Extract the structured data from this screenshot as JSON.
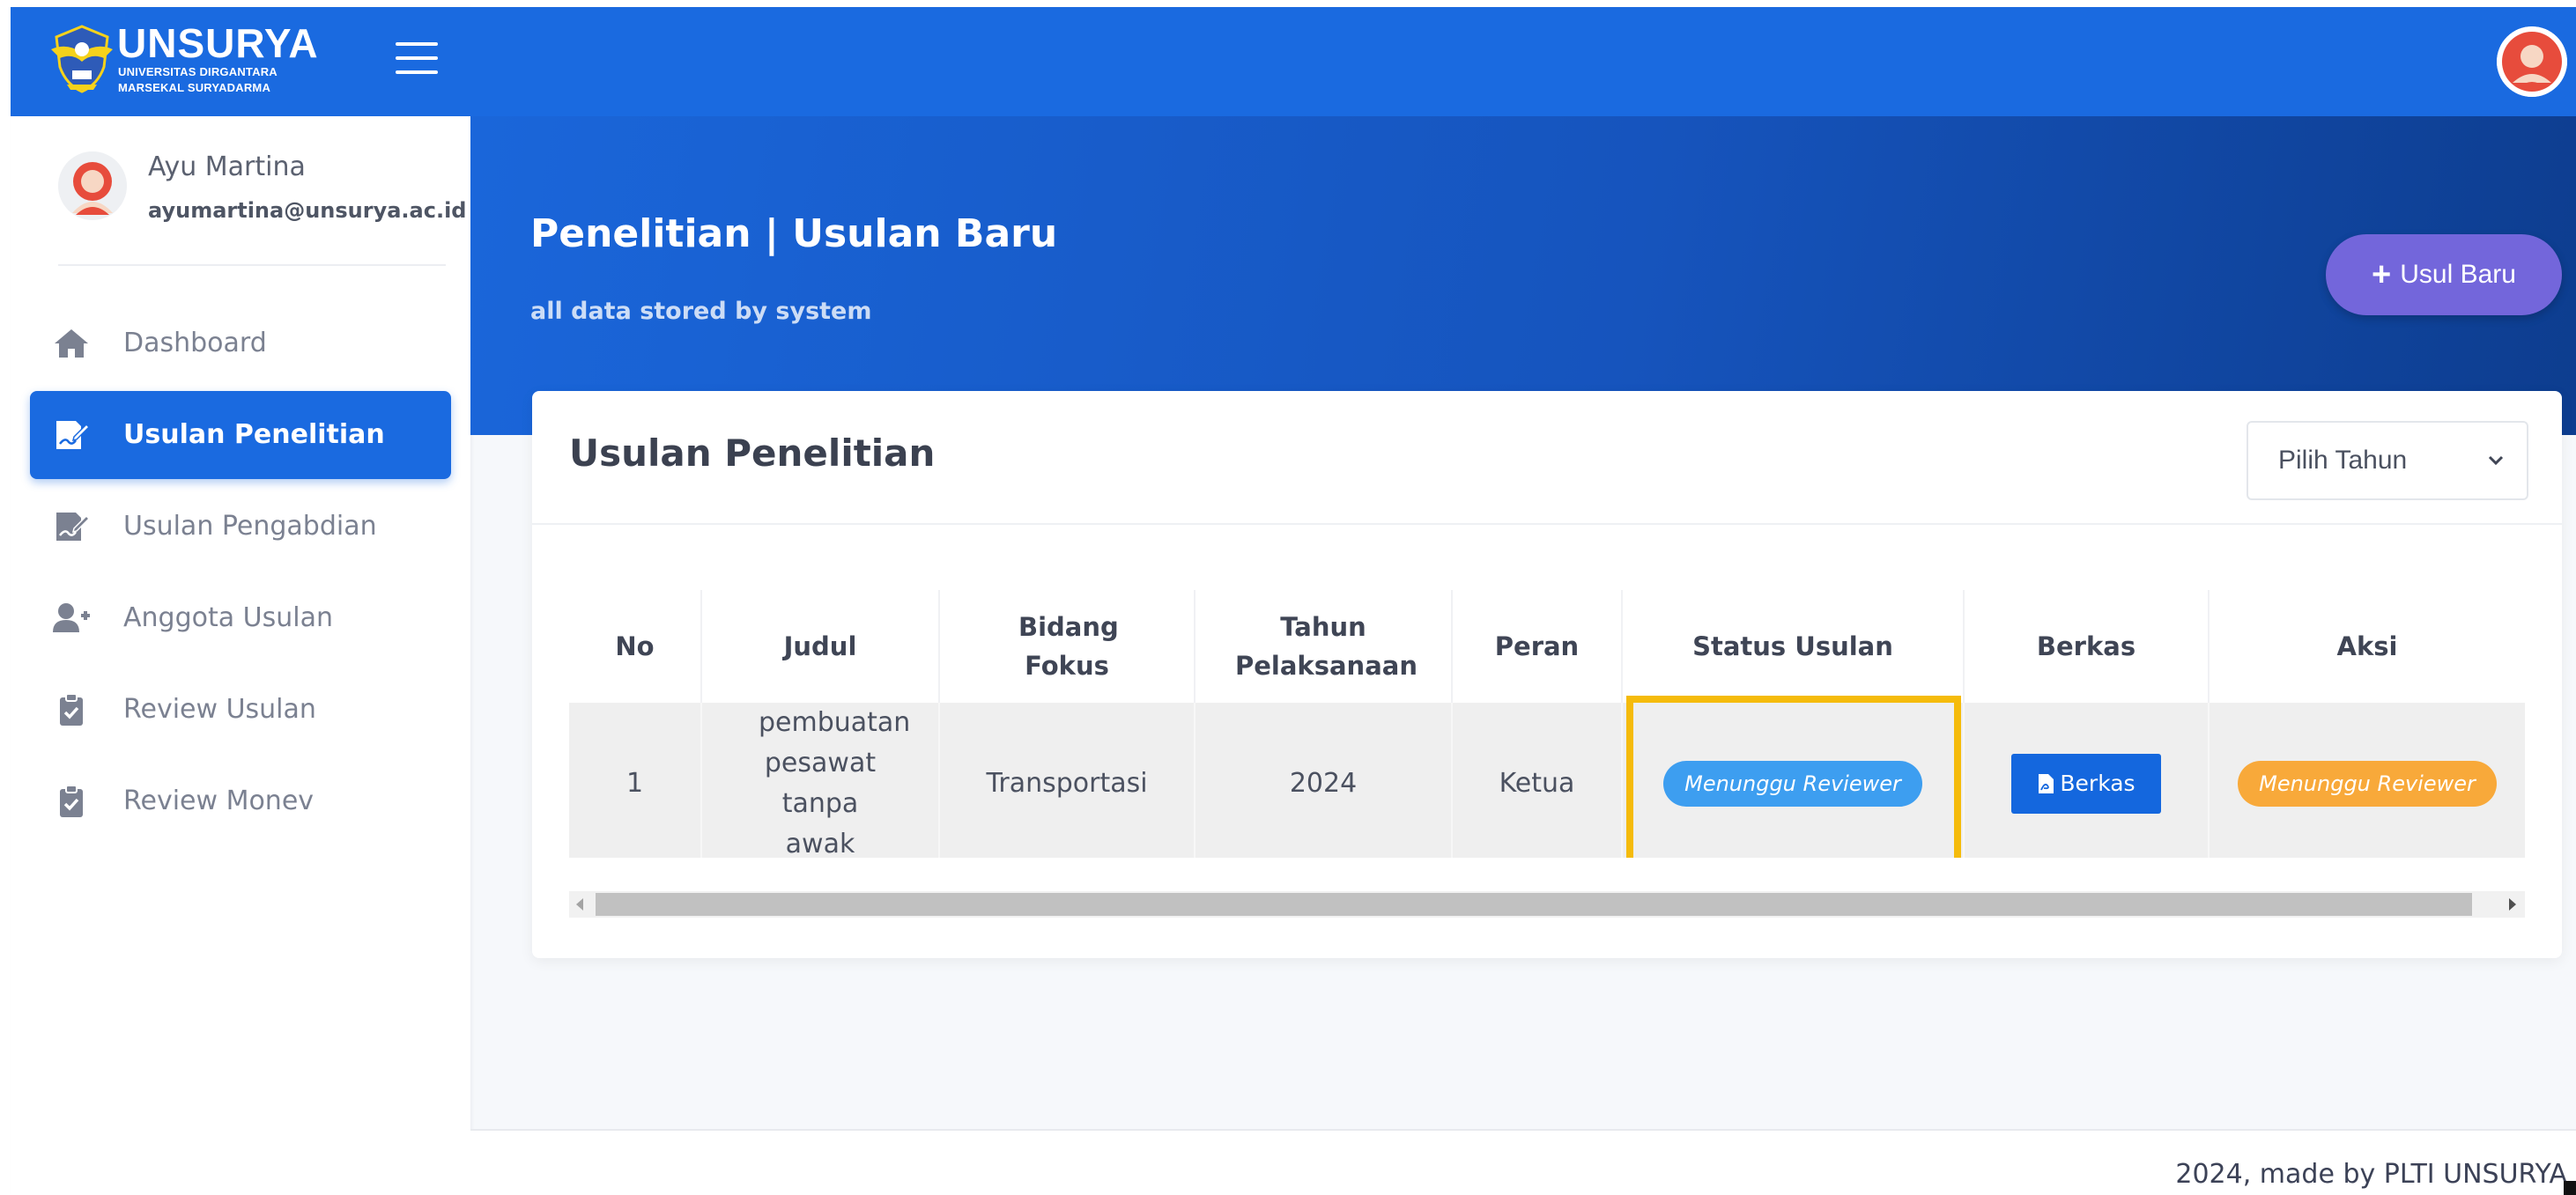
{
  "brand": {
    "name": "UNSURYA",
    "subtitle_line1": "UNIVERSITAS DIRGANTARA",
    "subtitle_line2": "MARSEKAL SURYADARMA",
    "color": "#1a6ae0"
  },
  "user": {
    "name": "Ayu Martina",
    "email": "ayumartina@unsurya.ac.id"
  },
  "sidebar": {
    "items": [
      {
        "label": "Dashboard",
        "icon": "home-icon",
        "active": false
      },
      {
        "label": "Usulan Penelitian",
        "icon": "signed-document-icon",
        "active": true
      },
      {
        "label": "Usulan Pengabdian",
        "icon": "signed-document-icon",
        "active": false
      },
      {
        "label": "Anggota Usulan",
        "icon": "user-plus-icon",
        "active": false
      },
      {
        "label": "Review Usulan",
        "icon": "clipboard-check-icon",
        "active": false
      },
      {
        "label": "Review Monev",
        "icon": "clipboard-check-icon",
        "active": false
      }
    ]
  },
  "header": {
    "title": "Penelitian | Usulan Baru",
    "subtitle": "all data stored by system",
    "new_button_label": "Usul Baru"
  },
  "card": {
    "title": "Usulan Penelitian",
    "year_select": {
      "selected": "Pilih Tahun"
    }
  },
  "table": {
    "columns": [
      "No",
      "Judul",
      "Bidang Fokus",
      "Tahun Pelaksanaan",
      "Peran",
      "Status Usulan",
      "Berkas",
      "Aksi"
    ],
    "rows": [
      {
        "no": "1",
        "judul": "pembuatan pesawat tanpa awak",
        "bidang_fokus": "Transportasi",
        "tahun": "2024",
        "peran": "Ketua",
        "status": "Menunggu Reviewer",
        "berkas_label": "Berkas",
        "aksi": "Menunggu Reviewer"
      }
    ]
  },
  "footer": {
    "text": "2024, made by PLTI UNSURYA"
  },
  "colors": {
    "primary": "#1a6ae0",
    "accent_button": "#7366db",
    "status_blue": "#3d9ef0",
    "status_orange": "#f8a93a",
    "highlight": "#f5bb0b"
  }
}
